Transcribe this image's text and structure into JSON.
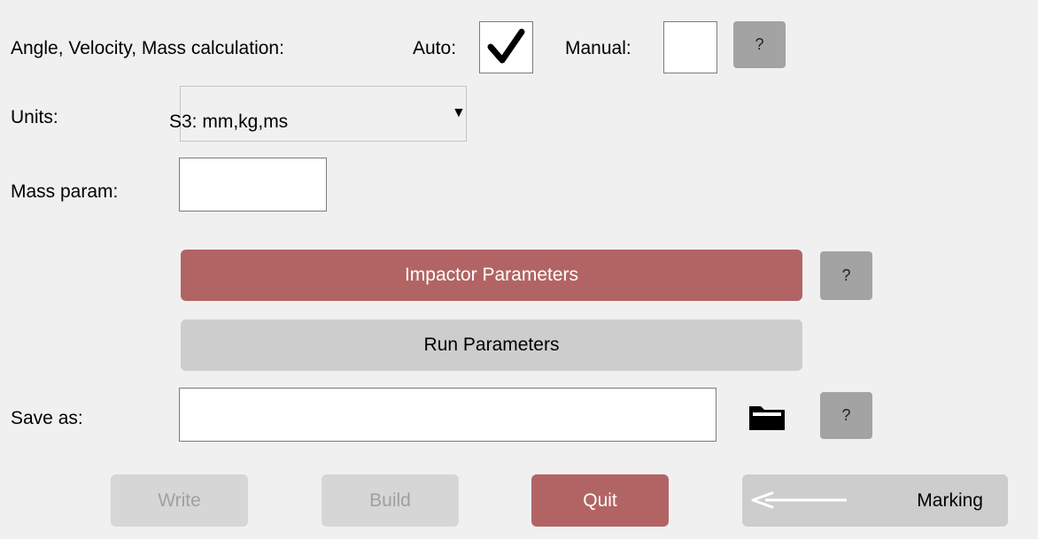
{
  "calc": {
    "label": "Angle, Velocity, Mass calculation:",
    "auto_label": "Auto:",
    "auto_checked": true,
    "manual_label": "Manual:",
    "manual_checked": false,
    "help_label": "?"
  },
  "units": {
    "label": "Units:",
    "selected": "S3: mm,kg,ms",
    "arrow": "▼"
  },
  "mass_param": {
    "label": "Mass param:",
    "value": ""
  },
  "impactor": {
    "label": "Impactor Parameters",
    "help_label": "?"
  },
  "run": {
    "label": "Run Parameters"
  },
  "save_as": {
    "label": "Save as:",
    "value": "",
    "help_label": "?"
  },
  "footer": {
    "write_label": "Write",
    "build_label": "Build",
    "quit_label": "Quit",
    "marking_label": "Marking"
  },
  "icons": {
    "checkmark": "checkmark-icon",
    "folder": "folder-icon",
    "arrow_left": "arrow-left-icon"
  },
  "colors": {
    "background": "#f0f0f0",
    "accent_red": "#b26464",
    "button_gray": "#cdcdcd",
    "help_gray": "#a3a3a3",
    "disabled_text": "#a0a0a0"
  }
}
